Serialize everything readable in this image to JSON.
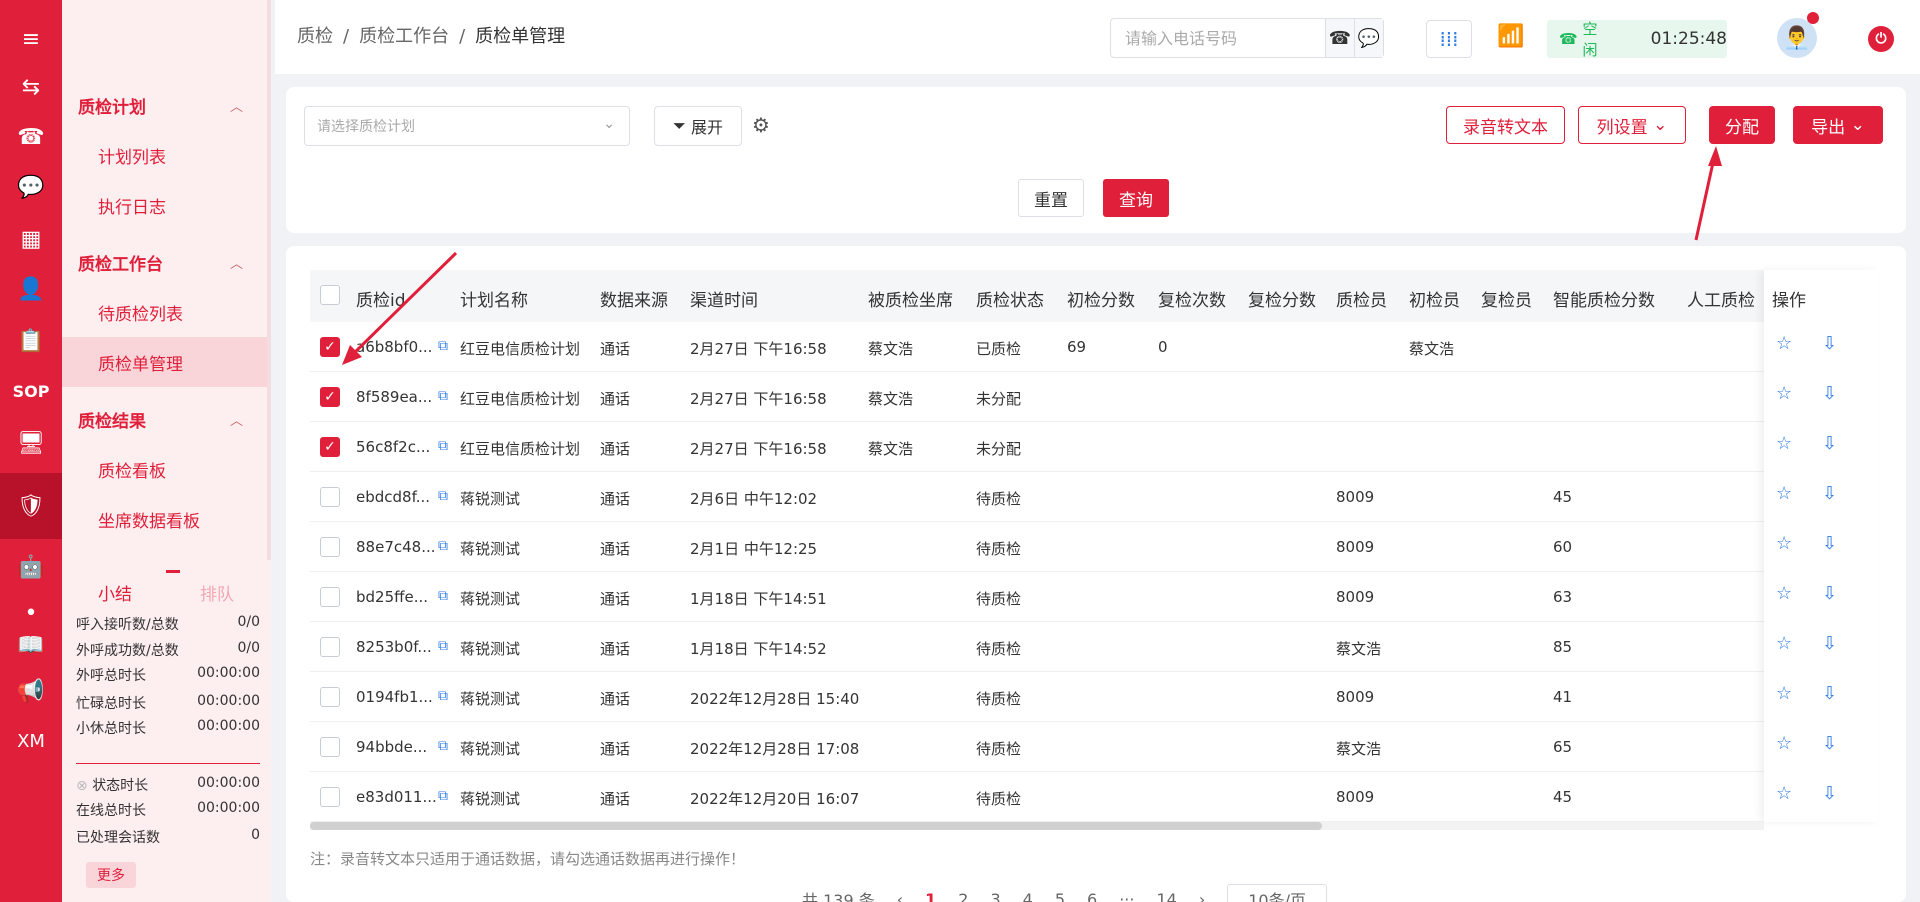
{
  "rail": {
    "items": [
      {
        "name": "menu-icon",
        "glyph": "≡"
      },
      {
        "name": "transfer-icon",
        "glyph": "⇆"
      },
      {
        "name": "telephone-icon",
        "glyph": "☎"
      },
      {
        "name": "chat-icon",
        "glyph": "💬"
      },
      {
        "name": "grid-icon",
        "glyph": "▦"
      },
      {
        "name": "person-icon",
        "glyph": "👤"
      },
      {
        "name": "clipboard-icon",
        "glyph": "📋"
      },
      {
        "name": "sop-text",
        "glyph": "SOP"
      },
      {
        "name": "monitor-icon",
        "glyph": "🖥"
      },
      {
        "name": "shield-check-icon",
        "glyph": "🛡"
      },
      {
        "name": "robot-icon",
        "glyph": "🤖"
      },
      {
        "name": "dot-icon",
        "glyph": "•"
      },
      {
        "name": "book-icon",
        "glyph": "📖"
      },
      {
        "name": "megaphone-icon",
        "glyph": "📢"
      },
      {
        "name": "xm-text",
        "glyph": "XM"
      }
    ]
  },
  "submenu": {
    "groups": [
      {
        "label": "质检计划",
        "items": [
          "计划列表",
          "执行日志"
        ]
      },
      {
        "label": "质检工作台",
        "items": [
          "待质检列表",
          "质检单管理"
        ]
      },
      {
        "label": "质检结果",
        "items": [
          "质检看板",
          "坐席数据看板"
        ]
      }
    ],
    "active": "质检单管理"
  },
  "stats": {
    "tab_summary": "小结",
    "tab_queue": "排队",
    "rows": [
      {
        "label": "呼入接听数/总数",
        "value": "0/0"
      },
      {
        "label": "外呼成功数/总数",
        "value": "0/0"
      },
      {
        "label": "外呼总时长",
        "value": "00:00:00"
      },
      {
        "label": "忙碌总时长",
        "value": "00:00:00"
      },
      {
        "label": "小休总时长",
        "value": "00:00:00"
      },
      {
        "label": "状态时长",
        "value": "00:00:00"
      },
      {
        "label": "在线总时长",
        "value": "00:00:00"
      },
      {
        "label": "已处理会话数",
        "value": "0"
      }
    ],
    "more": "更多"
  },
  "header": {
    "crumbs": [
      "质检",
      "质检工作台",
      "质检单管理"
    ],
    "phone_placeholder": "请输入电话号码",
    "status_label": "空闲",
    "status_time": "01:25:48"
  },
  "filter": {
    "plan_placeholder": "请选择质检计划",
    "expand": "展开",
    "btn_transcribe": "录音转文本",
    "btn_columns": "列设置",
    "btn_assign": "分配",
    "btn_export": "导出",
    "btn_reset": "重置",
    "btn_query": "查询"
  },
  "table": {
    "headers": [
      "质检id",
      "计划名称",
      "数据来源",
      "渠道时间",
      "被质检坐席",
      "质检状态",
      "初检分数",
      "复检次数",
      "复检分数",
      "质检员",
      "初检员",
      "复检员",
      "智能质检分数",
      "人工质检",
      "操作"
    ],
    "rows": [
      {
        "checked": true,
        "id": "a6b8bf0...",
        "plan": "红豆电信质检计划",
        "source": "通话",
        "time": "2月27日 下午16:58",
        "agent": "蔡文浩",
        "status": "已质检",
        "first": "69",
        "recount": "0",
        "rescore": "",
        "inspector": "",
        "first_insp": "蔡文浩",
        "re_insp": "",
        "ai": ""
      },
      {
        "checked": true,
        "id": "8f589ea...",
        "plan": "红豆电信质检计划",
        "source": "通话",
        "time": "2月27日 下午16:58",
        "agent": "蔡文浩",
        "status": "未分配",
        "first": "",
        "recount": "",
        "rescore": "",
        "inspector": "",
        "first_insp": "",
        "re_insp": "",
        "ai": ""
      },
      {
        "checked": true,
        "id": "56c8f2c...",
        "plan": "红豆电信质检计划",
        "source": "通话",
        "time": "2月27日 下午16:58",
        "agent": "蔡文浩",
        "status": "未分配",
        "first": "",
        "recount": "",
        "rescore": "",
        "inspector": "",
        "first_insp": "",
        "re_insp": "",
        "ai": ""
      },
      {
        "checked": false,
        "id": "ebdcd8f...",
        "plan": "蒋锐测试",
        "source": "通话",
        "time": "2月6日 中午12:02",
        "agent": "",
        "status": "待质检",
        "first": "",
        "recount": "",
        "rescore": "",
        "inspector": "8009",
        "first_insp": "",
        "re_insp": "",
        "ai": "45"
      },
      {
        "checked": false,
        "id": "88e7c48...",
        "plan": "蒋锐测试",
        "source": "通话",
        "time": "2月1日 中午12:25",
        "agent": "",
        "status": "待质检",
        "first": "",
        "recount": "",
        "rescore": "",
        "inspector": "8009",
        "first_insp": "",
        "re_insp": "",
        "ai": "60"
      },
      {
        "checked": false,
        "id": "bd25ffe...",
        "plan": "蒋锐测试",
        "source": "通话",
        "time": "1月18日 下午14:51",
        "agent": "",
        "status": "待质检",
        "first": "",
        "recount": "",
        "rescore": "",
        "inspector": "8009",
        "first_insp": "",
        "re_insp": "",
        "ai": "63"
      },
      {
        "checked": false,
        "id": "8253b0f...",
        "plan": "蒋锐测试",
        "source": "通话",
        "time": "1月18日 下午14:52",
        "agent": "",
        "status": "待质检",
        "first": "",
        "recount": "",
        "rescore": "",
        "inspector": "蔡文浩",
        "first_insp": "",
        "re_insp": "",
        "ai": "85"
      },
      {
        "checked": false,
        "id": "0194fb1...",
        "plan": "蒋锐测试",
        "source": "通话",
        "time": "2022年12月28日 15:40",
        "agent": "",
        "status": "待质检",
        "first": "",
        "recount": "",
        "rescore": "",
        "inspector": "8009",
        "first_insp": "",
        "re_insp": "",
        "ai": "41"
      },
      {
        "checked": false,
        "id": "94bbde...",
        "plan": "蒋锐测试",
        "source": "通话",
        "time": "2022年12月28日 17:08",
        "agent": "",
        "status": "待质检",
        "first": "",
        "recount": "",
        "rescore": "",
        "inspector": "蔡文浩",
        "first_insp": "",
        "re_insp": "",
        "ai": "65"
      },
      {
        "checked": false,
        "id": "e83d011...",
        "plan": "蒋锐测试",
        "source": "通话",
        "time": "2022年12月20日 16:07",
        "agent": "",
        "status": "待质检",
        "first": "",
        "recount": "",
        "rescore": "",
        "inspector": "8009",
        "first_insp": "",
        "re_insp": "",
        "ai": "45"
      }
    ],
    "note": "注：录音转文本只适用于通话数据，请勾选通话数据再进行操作！",
    "pager": {
      "total": "共 139 条",
      "prev": "‹",
      "pages": [
        "1",
        "2",
        "3",
        "4",
        "5",
        "6",
        "···",
        "14"
      ],
      "current": "1",
      "next": "›",
      "size": "10条/页"
    }
  },
  "colors": {
    "brand": "#e0203a",
    "link": "#2f7be8"
  }
}
